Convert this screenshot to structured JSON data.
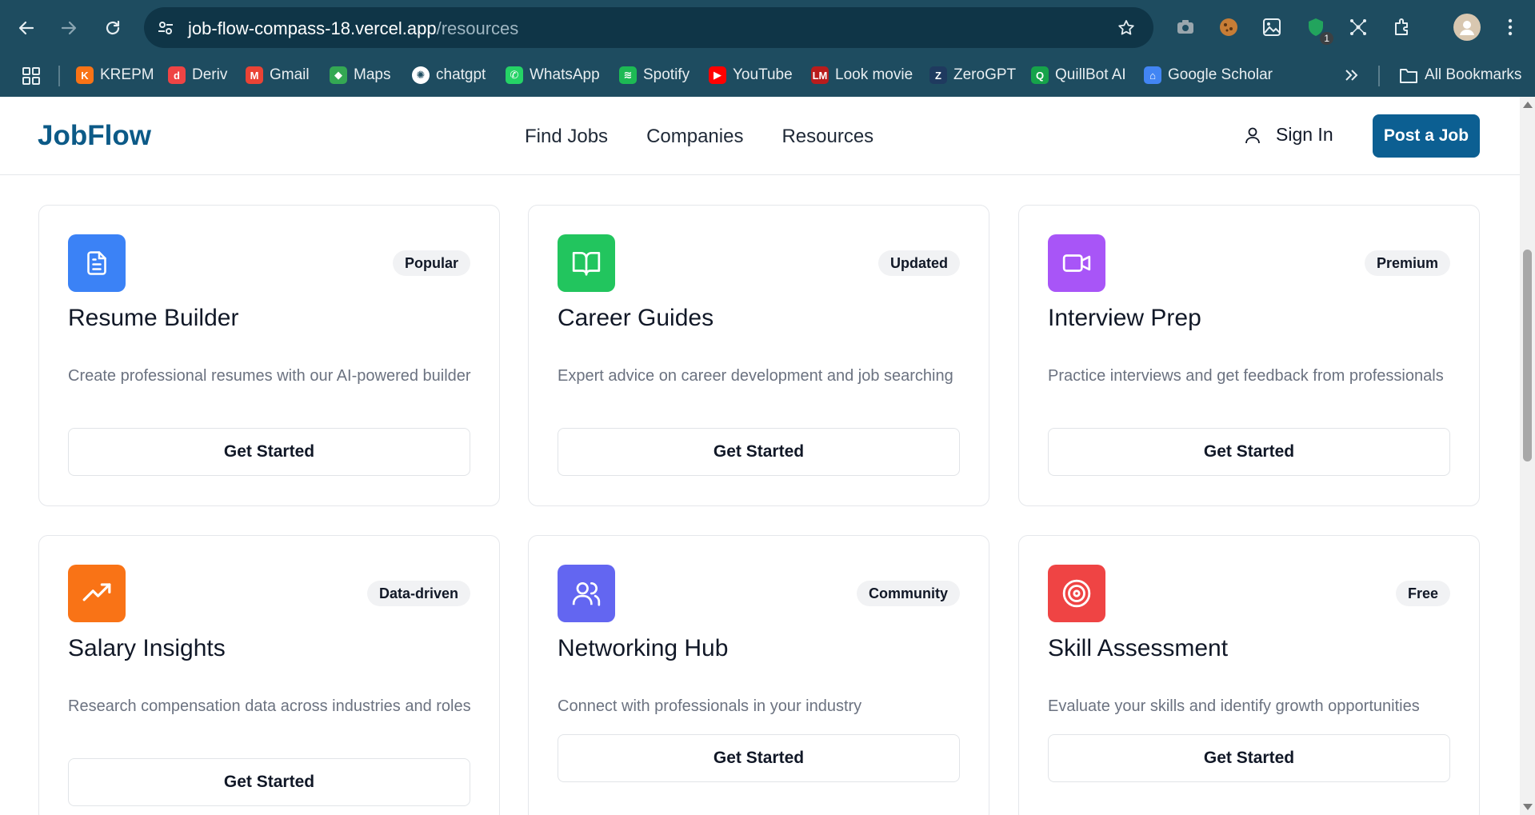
{
  "browser": {
    "url_host": "job-flow-compass-18.vercel.app",
    "url_path": "/resources",
    "extension_badge": "1",
    "bookmarks": [
      {
        "label": "KREPM",
        "icon": "krepm-icon",
        "color": "#f97316"
      },
      {
        "label": "Deriv",
        "icon": "deriv-icon",
        "color": "#ef4444"
      },
      {
        "label": "Gmail",
        "icon": "gmail-icon",
        "color": "#ea4335"
      },
      {
        "label": "Maps",
        "icon": "maps-icon",
        "color": "#34a853"
      },
      {
        "label": "chatgpt",
        "icon": "chatgpt-icon",
        "color": "#ffffff"
      },
      {
        "label": "WhatsApp",
        "icon": "whatsapp-icon",
        "color": "#25d366"
      },
      {
        "label": "Spotify",
        "icon": "spotify-icon",
        "color": "#1db954"
      },
      {
        "label": "YouTube",
        "icon": "youtube-icon",
        "color": "#ff0000"
      },
      {
        "label": "Look movie",
        "icon": "lookmovie-icon",
        "color": "#b91c1c"
      },
      {
        "label": "ZeroGPT",
        "icon": "zerogpt-icon",
        "color": "#1f3a5f"
      },
      {
        "label": "QuillBot AI",
        "icon": "quillbot-icon",
        "color": "#16a34a"
      },
      {
        "label": "Google Scholar",
        "icon": "google-scholar-icon",
        "color": "#4285f4"
      }
    ],
    "all_bookmarks": "All Bookmarks"
  },
  "header": {
    "logo": "JobFlow",
    "nav": [
      "Find Jobs",
      "Companies",
      "Resources"
    ],
    "sign_in": "Sign In",
    "post_job": "Post a Job"
  },
  "cards": [
    {
      "title": "Resume Builder",
      "badge": "Popular",
      "description": "Create professional resumes with our AI-powered builder",
      "button": "Get Started",
      "icon": "document-icon",
      "color": "#3b82f6"
    },
    {
      "title": "Career Guides",
      "badge": "Updated",
      "description": "Expert advice on career development and job searching",
      "button": "Get Started",
      "icon": "book-open-icon",
      "color": "#22c55e"
    },
    {
      "title": "Interview Prep",
      "badge": "Premium",
      "description": "Practice interviews and get feedback from professionals",
      "button": "Get Started",
      "icon": "video-icon",
      "color": "#a855f7"
    },
    {
      "title": "Salary Insights",
      "badge": "Data-driven",
      "description": "Research compensation data across industries and roles",
      "button": "Get Started",
      "icon": "trending-up-icon",
      "color": "#f97316"
    },
    {
      "title": "Networking Hub",
      "badge": "Community",
      "description": "Connect with professionals in your industry",
      "button": "Get Started",
      "icon": "users-icon",
      "color": "#6366f1"
    },
    {
      "title": "Skill Assessment",
      "badge": "Free",
      "description": "Evaluate your skills and identify growth opportunities",
      "button": "Get Started",
      "icon": "target-icon",
      "color": "#ef4444"
    }
  ]
}
